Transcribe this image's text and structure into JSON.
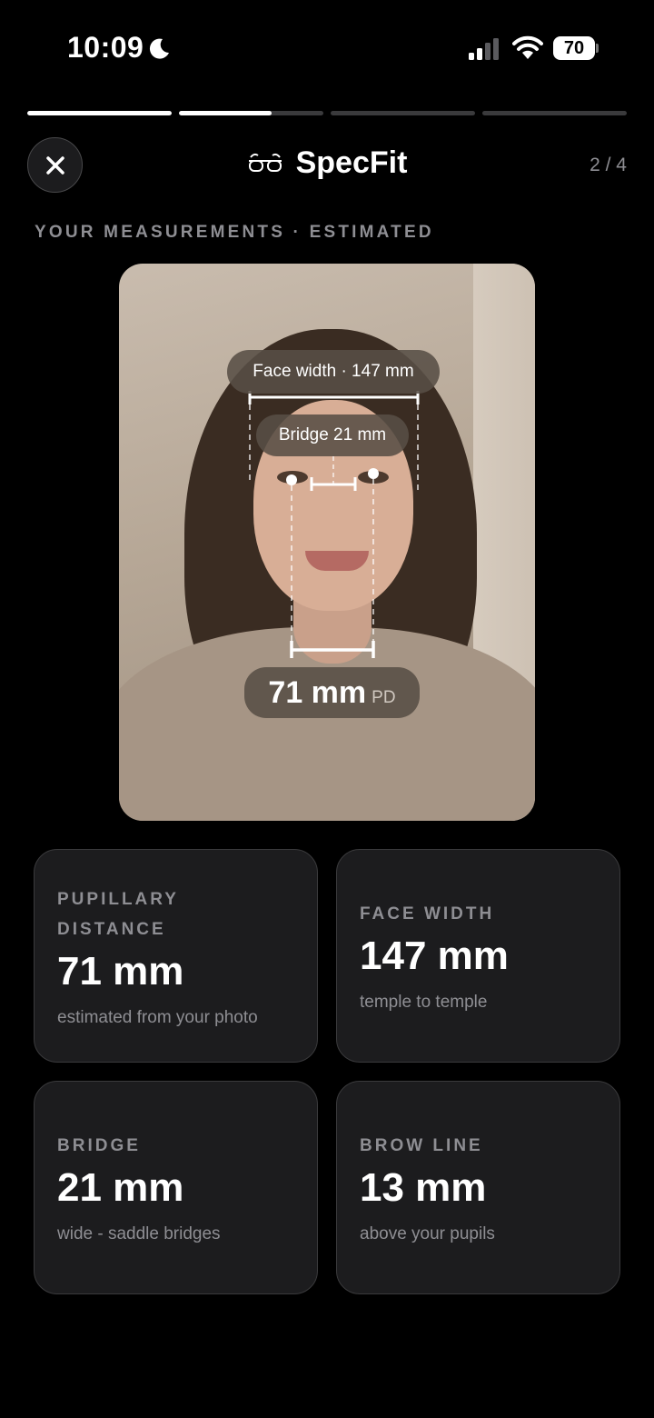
{
  "status_bar": {
    "time": "10:09",
    "battery": "70"
  },
  "progress": {
    "segments": [
      1,
      0.64,
      0,
      0
    ]
  },
  "header": {
    "brand": "SpecFit",
    "step": "2 / 4"
  },
  "section_label": "YOUR MEASUREMENTS · ESTIMATED",
  "photo_overlay": {
    "face_width": "Face width · 147 mm",
    "bridge": "Bridge 21 mm",
    "pd_value": "71 mm",
    "pd_unit": "PD"
  },
  "cards": [
    {
      "label": "PUPILLARY DISTANCE",
      "value": "71 mm",
      "sub": "estimated from your photo"
    },
    {
      "label": "FACE WIDTH",
      "value": "147 mm",
      "sub": "temple to temple"
    },
    {
      "label": "BRIDGE",
      "value": "21 mm",
      "sub": "wide - saddle bridges"
    },
    {
      "label": "BROW LINE",
      "value": "13 mm",
      "sub": "above your pupils"
    }
  ],
  "icons": [
    "moon-icon",
    "signal-icon",
    "wifi-icon",
    "battery-icon",
    "close-icon",
    "glasses-icon"
  ]
}
